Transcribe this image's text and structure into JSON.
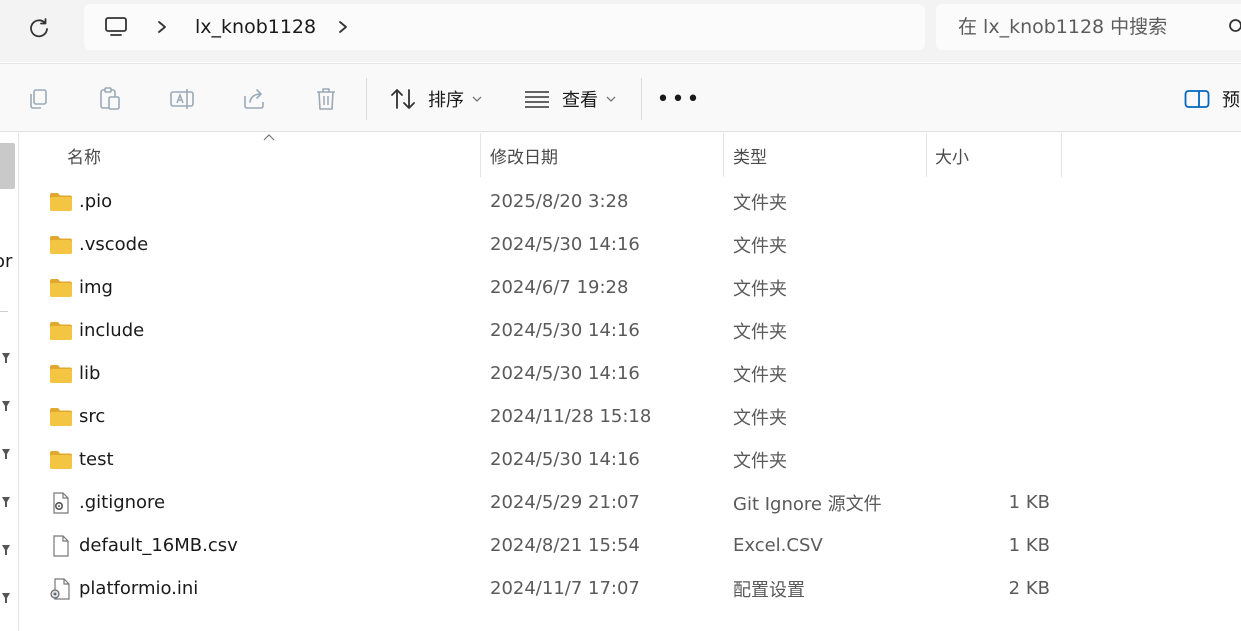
{
  "address_bar": {
    "refresh_icon": "refresh-icon",
    "computer_icon": "computer-icon",
    "breadcrumb": [
      "lx_knob1128"
    ],
    "search_placeholder": "在 lx_knob1128 中搜索"
  },
  "toolbar": {
    "sort_label": "排序",
    "view_label": "查看",
    "more_label": "•••",
    "preview_label": "预"
  },
  "nav_pane": {
    "partial_text": "or"
  },
  "columns": {
    "name": "名称",
    "modified": "修改日期",
    "type": "类型",
    "size": "大小"
  },
  "files": [
    {
      "name": ".pio",
      "modified": "2025/8/20 3:28",
      "type": "文件夹",
      "size": "",
      "icon": "folder-icon"
    },
    {
      "name": ".vscode",
      "modified": "2024/5/30 14:16",
      "type": "文件夹",
      "size": "",
      "icon": "folder-icon"
    },
    {
      "name": "img",
      "modified": "2024/6/7 19:28",
      "type": "文件夹",
      "size": "",
      "icon": "folder-icon"
    },
    {
      "name": "include",
      "modified": "2024/5/30 14:16",
      "type": "文件夹",
      "size": "",
      "icon": "folder-icon"
    },
    {
      "name": "lib",
      "modified": "2024/5/30 14:16",
      "type": "文件夹",
      "size": "",
      "icon": "folder-icon"
    },
    {
      "name": "src",
      "modified": "2024/11/28 15:18",
      "type": "文件夹",
      "size": "",
      "icon": "folder-icon"
    },
    {
      "name": "test",
      "modified": "2024/5/30 14:16",
      "type": "文件夹",
      "size": "",
      "icon": "folder-icon"
    },
    {
      "name": ".gitignore",
      "modified": "2024/5/29 21:07",
      "type": "Git Ignore 源文件",
      "size": "1 KB",
      "icon": "settings-file-icon"
    },
    {
      "name": "default_16MB.csv",
      "modified": "2024/8/21 15:54",
      "type": "Excel.CSV",
      "size": "1 KB",
      "icon": "blank-file-icon"
    },
    {
      "name": "platformio.ini",
      "modified": "2024/11/7 17:07",
      "type": "配置设置",
      "size": "2 KB",
      "icon": "config-file-icon"
    }
  ],
  "colors": {
    "folder": "#f4c542",
    "folder_dark": "#e0a82e",
    "accent": "#0067c0"
  }
}
